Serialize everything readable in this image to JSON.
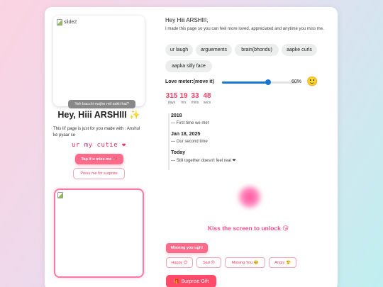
{
  "left": {
    "slide_alt": "slide2",
    "slide_caption": "Yeh bacchi mujhe mil sakti hai?",
    "title": "Hey, Hiii ARSHIII ✨",
    "intro": "This lil' page is just for you made with : Anshul ke pyaar se",
    "cutie": "ur my cutie ❤",
    "tap_button": "Tap if u miss me 💖",
    "surprise_button": "Press me for surprise"
  },
  "right": {
    "greeting": "Hey Hiii ARSHIII,",
    "subtext": "I made this page so you can feel more loved, appreciated and anytime you miss me.",
    "chips": [
      "ur laugh",
      "arguements",
      "brain(bhondu)",
      "aapke curls",
      "aapka silly face"
    ],
    "love_meter": {
      "label": "Love meter:(move it)",
      "value": 60,
      "value_text": "60%",
      "emoji": "🙂"
    },
    "countdown": [
      {
        "value": "315",
        "unit": "days"
      },
      {
        "value": "19",
        "unit": "hrs"
      },
      {
        "value": "33",
        "unit": "mins"
      },
      {
        "value": "48",
        "unit": "secs"
      }
    ],
    "timeline": [
      {
        "date": "2018",
        "note": "— First time we met"
      },
      {
        "date": "Jan 18, 2025",
        "note": "— Our second time"
      },
      {
        "date": "Today",
        "note": "— Still together doesn't feel real ❤"
      }
    ],
    "kiss_text": "Kiss the screen to unlock 😘",
    "missing_button": "Missing you ugh!",
    "moods": [
      "Happy 😊",
      "Sad 😔",
      "Missing You 🥺",
      "Angry 😤"
    ],
    "gift_button": "🎁 Surprise Gift"
  },
  "colors": {
    "accent": "#ff6b8b",
    "countdown": "#ef3f64",
    "slider": "#1976d2"
  }
}
